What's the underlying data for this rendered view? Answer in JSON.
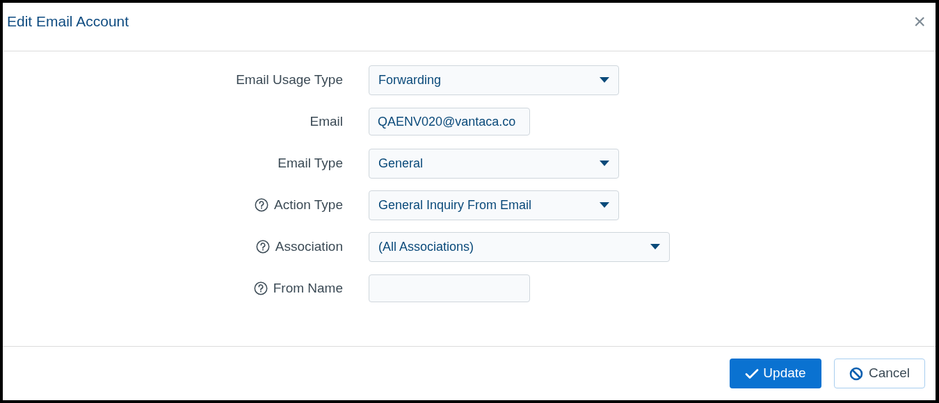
{
  "dialog": {
    "title": "Edit Email Account",
    "close": "×"
  },
  "fields": [
    {
      "label": "Email Usage Type",
      "kind": "select",
      "value": "Forwarding",
      "help": false,
      "wide": false
    },
    {
      "label": "Email",
      "kind": "text",
      "value": "QAENV020@vantaca.co",
      "help": false,
      "wide": false
    },
    {
      "label": "Email Type",
      "kind": "select",
      "value": "General",
      "help": false,
      "wide": false
    },
    {
      "label": "Action Type",
      "kind": "select",
      "value": "General Inquiry From Email",
      "help": true,
      "wide": false
    },
    {
      "label": "Association",
      "kind": "select",
      "value": "(All Associations)",
      "help": true,
      "wide": true
    },
    {
      "label": "From Name",
      "kind": "text",
      "help": true,
      "wide": false
    }
  ],
  "buttons": [
    {
      "label": "Update",
      "kind": "primary"
    },
    {
      "label": "Cancel",
      "kind": "secondary"
    }
  ]
}
